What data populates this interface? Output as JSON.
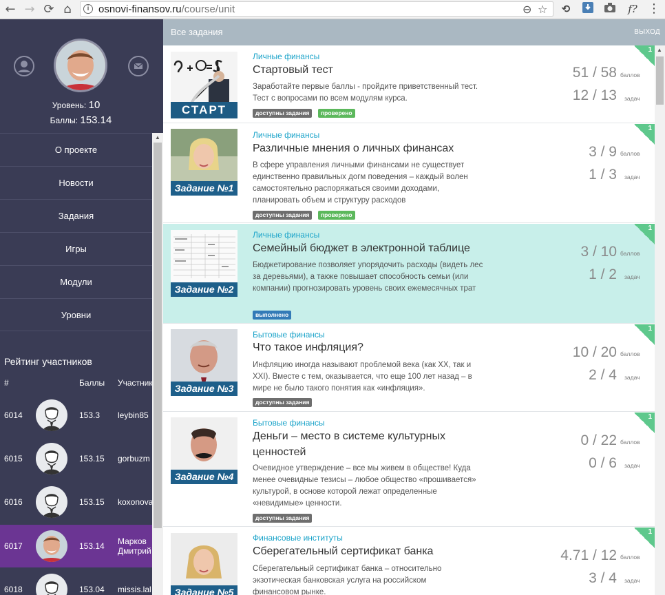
{
  "browser": {
    "back": "←",
    "forward": "→",
    "reload": "⟳",
    "home": "⌂",
    "url_host": "osnovi-finansov.ru",
    "url_path": "/course/unit",
    "zoom_icon": "⊖",
    "star_icon": "☆",
    "ext_fx": "f?"
  },
  "sidebar": {
    "level_label": "Уровень:",
    "level_value": "10",
    "score_label": "Баллы:",
    "score_value": "153.14",
    "menu": [
      {
        "label": "О проекте"
      },
      {
        "label": "Новости"
      },
      {
        "label": "Задания"
      },
      {
        "label": "Игры"
      },
      {
        "label": "Модули"
      },
      {
        "label": "Уровни"
      }
    ],
    "rating_title": "Рейтинг участников",
    "rating_headers": {
      "rank": "#",
      "score": "Баллы",
      "name": "Участник"
    },
    "rating": [
      {
        "rank": "6014",
        "score": "153.3",
        "name": "leybin85"
      },
      {
        "rank": "6015",
        "score": "153.15",
        "name": "gorbuzm"
      },
      {
        "rank": "6016",
        "score": "153.15",
        "name": "koxonova"
      },
      {
        "rank": "6017",
        "score": "153.14",
        "name": "Марков Дмитрий"
      },
      {
        "rank": "6018",
        "score": "153.04",
        "name": "missis.lal"
      }
    ]
  },
  "main": {
    "title": "Все задания",
    "logout": "ВЫХОД",
    "points_label": "баллов",
    "tasks_label": "задач",
    "tasks": [
      {
        "category": "Личные финансы",
        "title": "Стартовый тест",
        "desc": "Заработайте первые баллы - пройдите приветственный тест. Тест с вопросами по всем модулям курса.",
        "badges": [
          "доступны задания",
          "проверено"
        ],
        "points": "51 / 58",
        "count": "12 / 13",
        "corner": "1",
        "thumb_label": "СТАРТ"
      },
      {
        "category": "Личные финансы",
        "title": "Различные мнения о личных финансах",
        "desc": "В сфере управления личными финансами не существует единственно правильных догм поведения – каждый волен самостоятельно распоряжаться своими доходами, планировать объем и структуру расходов",
        "badges": [
          "доступны задания",
          "проверено"
        ],
        "points": "3 / 9",
        "count": "1 / 3",
        "corner": "1",
        "thumb_label": "Задание №1"
      },
      {
        "category": "Личные финансы",
        "title": "Семейный бюджет в электронной таблице",
        "desc": "Бюджетирование позволяет упорядочить расходы (видеть лес за деревьями), а также повышает способность семьи (или компании) прогнозировать уровень своих ежемесячных трат",
        "badges": [
          "выполнено"
        ],
        "points": "3 / 10",
        "count": "1 / 2",
        "corner": "1",
        "thumb_label": "Задание №2"
      },
      {
        "category": "Бытовые финансы",
        "title": "Что такое инфляция?",
        "desc": "Инфляцию иногда называют проблемой века (как XX, так и XXI). Вместе с тем, оказывается, что еще 100 лет назад – в мире не было такого понятия как «инфляция».",
        "badges": [
          "доступны задания"
        ],
        "points": "10 / 20",
        "count": "2 / 4",
        "corner": "1",
        "thumb_label": "Задание №3"
      },
      {
        "category": "Бытовые финансы",
        "title": "Деньги – место в системе культурных ценностей",
        "desc": "Очевидное утверждение – все мы живем в обществе! Куда менее очевидные тезисы – любое общество «прошивается» культурой, в основе которой лежат определенные «невидимые» ценности.",
        "badges": [
          "доступны задания"
        ],
        "points": "0 / 22",
        "count": "0 / 6",
        "corner": "1",
        "thumb_label": "Задание №4"
      },
      {
        "category": "Финансовые институты",
        "title": "Сберегательный сертификат банка",
        "desc": "Сберегательный сертификат банка – относительно экзотическая банковская услуга на российском финансовом рынке.",
        "badges": [],
        "points": "4.71 / 12",
        "count": "3 / 4",
        "corner": "1",
        "thumb_label": "Задание №5"
      }
    ]
  },
  "colors": {
    "sidebar_bg": "#3a3c55",
    "active_row": "#6b3593",
    "header_bg": "#aab8c2",
    "category": "#1aa3c9",
    "done_bg": "#c8efea",
    "corner": "#5ec88c"
  }
}
